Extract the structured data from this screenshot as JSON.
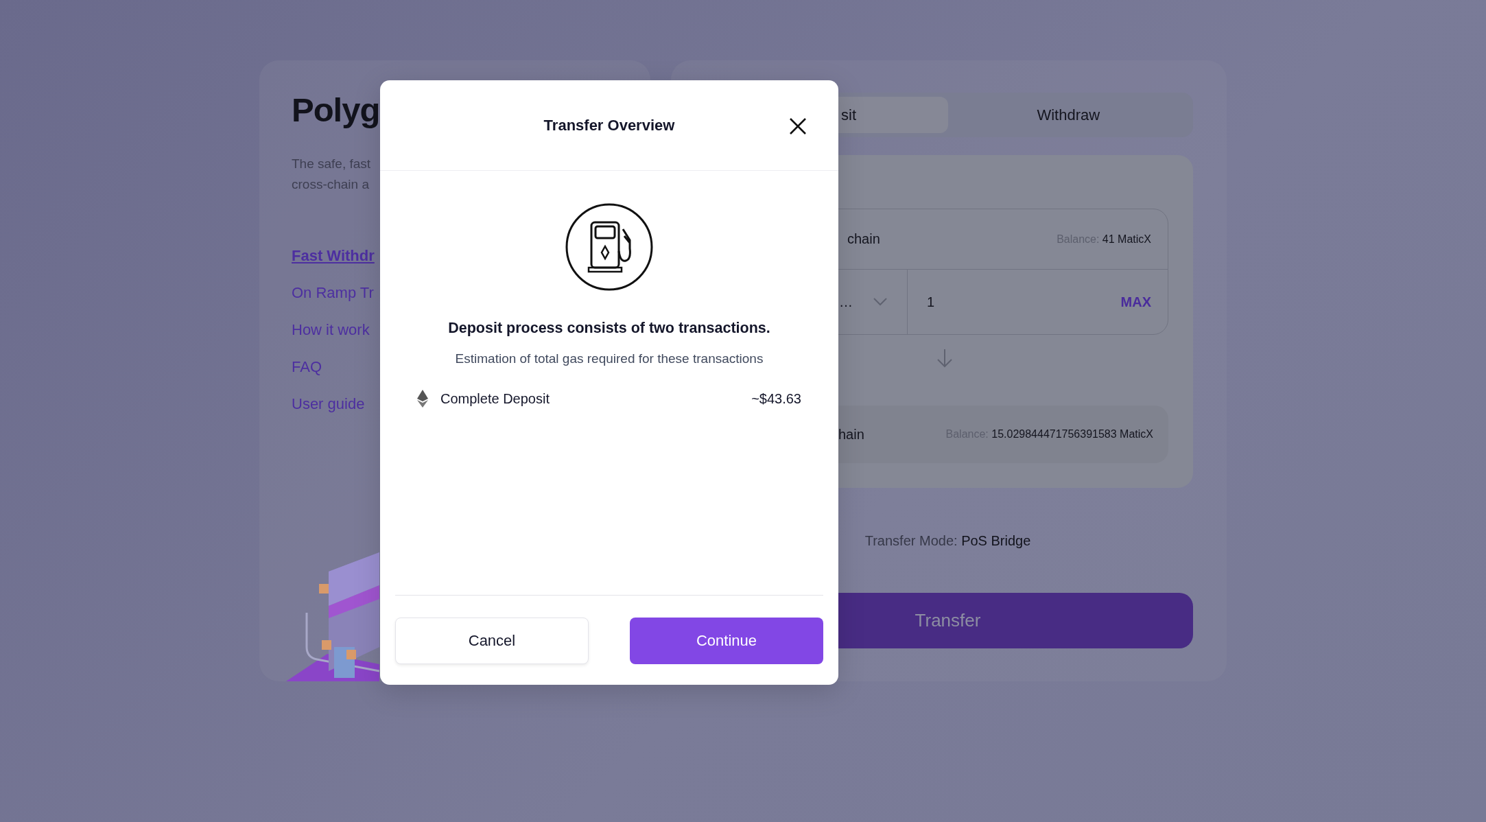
{
  "sidebar": {
    "title": "Polyg",
    "tagline": [
      "The safe, fast",
      "cross-chain a"
    ],
    "links": [
      {
        "label": "Fast Withdr",
        "selected": true
      },
      {
        "label": "On Ramp Tr",
        "selected": false
      },
      {
        "label": "How it work",
        "selected": false
      },
      {
        "label": "FAQ",
        "selected": false
      },
      {
        "label": "User guide",
        "selected": false
      }
    ]
  },
  "transfer_panel": {
    "tabs": [
      {
        "label": "sit",
        "selected": true
      },
      {
        "label": "Withdraw",
        "selected": false
      }
    ],
    "from": {
      "network": "chain",
      "balance_label": "Balance:",
      "balance": "41 MaticX",
      "token": "…",
      "amount": "1",
      "max_button": "MAX"
    },
    "to": {
      "network": "hain",
      "balance_label": "Balance:",
      "balance": "15.029844471756391583 MaticX"
    },
    "transfer_mode_label": "Transfer Mode:",
    "transfer_mode": "PoS Bridge",
    "submit_button": "Transfer"
  },
  "modal": {
    "title": "Transfer Overview",
    "heading": "Deposit process consists of two transactions.",
    "description": "Estimation of total gas required for these transactions",
    "items": [
      {
        "label": "Complete Deposit",
        "amount": "~$43.63"
      }
    ],
    "buttons": [
      {
        "label": "Cancel",
        "kind": "secondary"
      },
      {
        "label": "Continue",
        "kind": "primary"
      }
    ]
  }
}
